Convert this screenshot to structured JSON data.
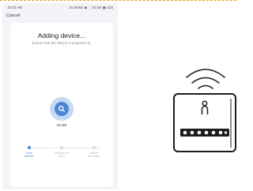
{
  "status_bar": {
    "time": "10:02 AM",
    "right": "15.0KB/s ◆ ⬚ 5ⅈl 5ⅈl ▣ (30)"
  },
  "header": {
    "cancel_label": "Cancel"
  },
  "main": {
    "title": "Adding device...",
    "subtitle": "Ensure that the device is powered on.",
    "timer": "01:59"
  },
  "steps": [
    {
      "label_1": "Scan",
      "label_2": "devices.",
      "active": true
    },
    {
      "label_1": "Register on",
      "label_2": "Cloud.",
      "active": false
    },
    {
      "label_1": "Initialize",
      "label_2": "the device.",
      "active": false
    }
  ],
  "colors": {
    "accent": "#4a86d6",
    "halo": "#c6d8f2",
    "background": "#f3f4f7"
  },
  "icons": {
    "search": "search-icon",
    "wifi": "wifi-signal-icon",
    "device": "smart-relay-module-icon"
  }
}
